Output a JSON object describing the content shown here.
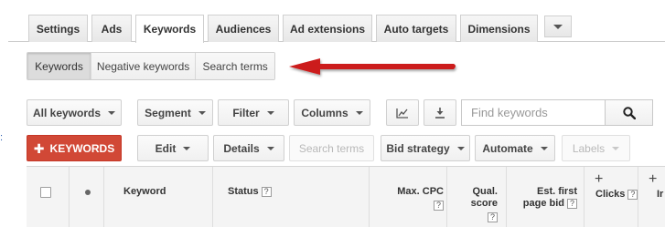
{
  "tabs": [
    {
      "label": "Settings"
    },
    {
      "label": "Ads"
    },
    {
      "label": "Keywords",
      "active": true
    },
    {
      "label": "Audiences"
    },
    {
      "label": "Ad extensions"
    },
    {
      "label": "Auto targets"
    },
    {
      "label": "Dimensions"
    }
  ],
  "subtabs": [
    {
      "label": "Keywords",
      "active": true
    },
    {
      "label": "Negative keywords"
    },
    {
      "label": "Search terms"
    }
  ],
  "toolbar": {
    "all_keywords": "All keywords",
    "segment": "Segment",
    "filter": "Filter",
    "columns": "Columns",
    "search_placeholder": "Find keywords",
    "add_keywords": "KEYWORDS",
    "edit": "Edit",
    "details": "Details",
    "search_terms": "Search terms",
    "bid_strategy": "Bid strategy",
    "automate": "Automate",
    "labels": "Labels"
  },
  "table": {
    "headers": {
      "keyword": "Keyword",
      "status": "Status",
      "max_cpc": "Max. CPC",
      "qual_score_line1": "Qual.",
      "qual_score_line2": "score",
      "est_bid_line1": "Est. first",
      "est_bid_line2": "page bid",
      "clicks": "Clicks",
      "impr_fragment": "Ir"
    },
    "help_mark": "?"
  },
  "colors": {
    "accent_red": "#d14836",
    "arrow_red": "#cc1f1f"
  }
}
